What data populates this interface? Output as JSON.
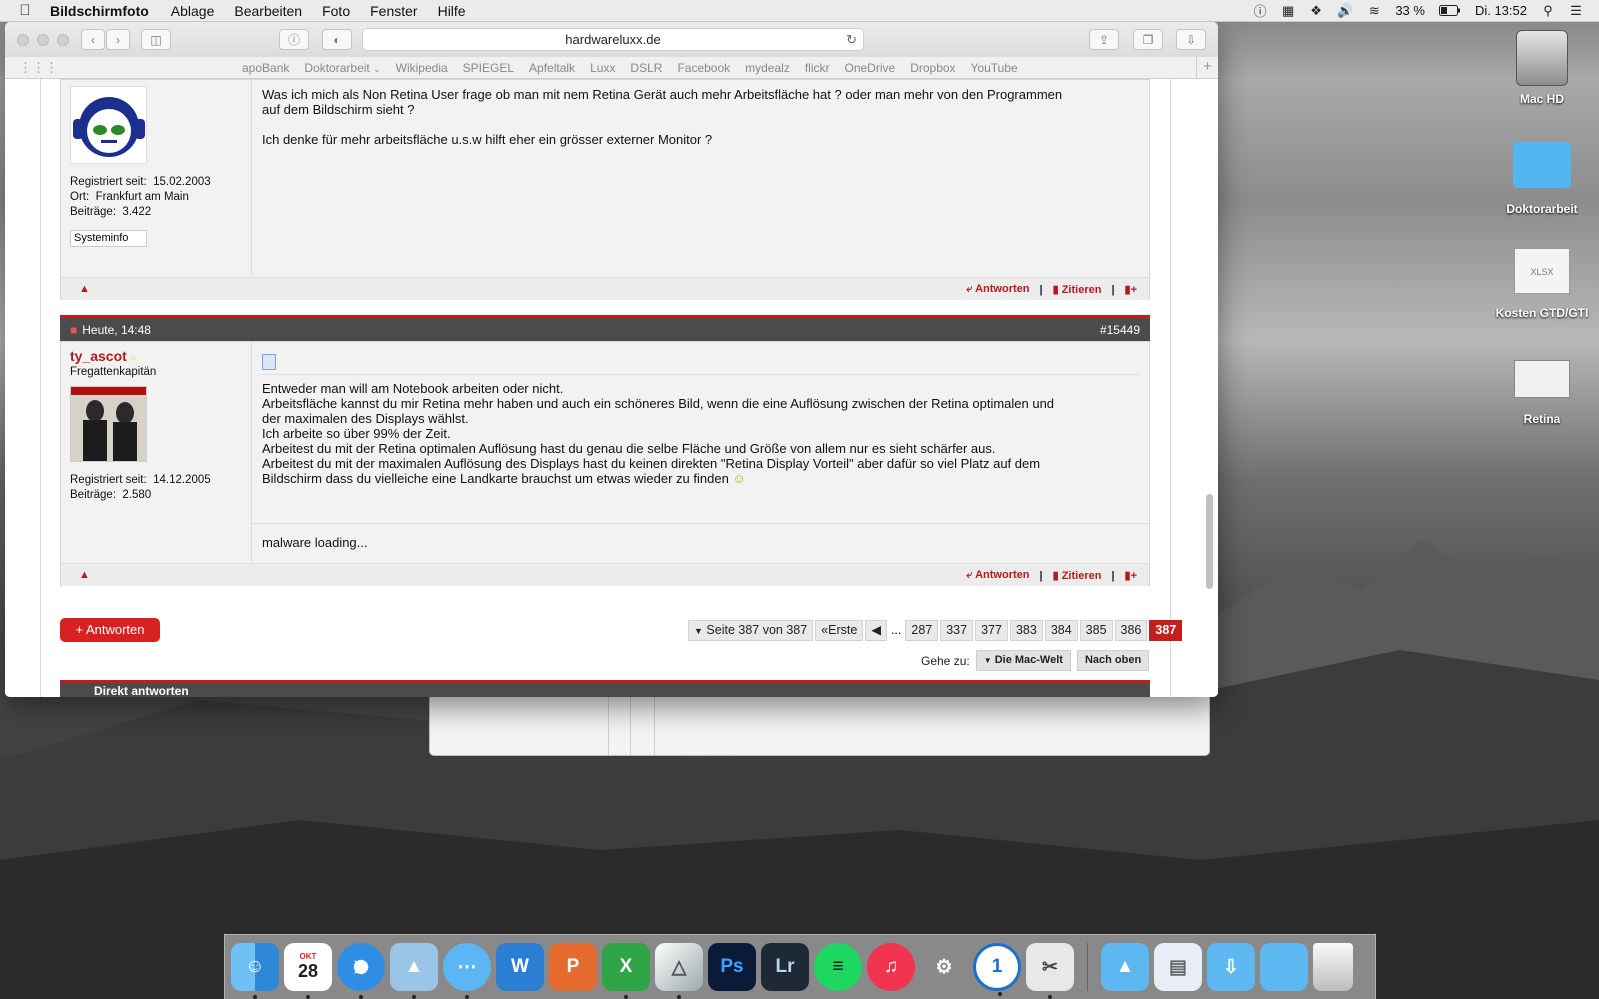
{
  "menubar": {
    "app": "Bildschirmfoto",
    "menus": [
      "Ablage",
      "Bearbeiten",
      "Foto",
      "Fenster",
      "Hilfe"
    ],
    "battery": "33 %",
    "clock": "Di. 13:52"
  },
  "desktop": {
    "icons": [
      {
        "label": "Mac HD"
      },
      {
        "label": "Doktorarbeit"
      },
      {
        "label": "Kosten GTD/GTI",
        "file_type": "XLSX"
      },
      {
        "label": "Retina"
      }
    ]
  },
  "safari": {
    "url": "hardwareluxx.de",
    "favorites": [
      "apoBank",
      "Doktorarbeit",
      "Wikipedia",
      "SPIEGEL",
      "Apfeltalk",
      "Luxx",
      "DSLR",
      "Facebook",
      "mydealz",
      "flickr",
      "OneDrive",
      "Dropbox",
      "YouTube"
    ]
  },
  "post1": {
    "text1": "Was ich mich als Non Retina User frage ob man mit nem Retina Gerät auch mehr Arbeitsfläche hat ? oder man mehr von den Programmen",
    "text2": "auf dem Bildschirm sieht ?",
    "text3": "Ich denke für mehr arbeitsfläche u.s.w hilft eher ein grösser externer Monitor ?",
    "registered_label": "Registriert seit:",
    "registered": "15.02.2003",
    "location_label": "Ort:",
    "location": "Frankfurt am Main",
    "posts_label": "Beiträge:",
    "posts": "3.422",
    "sysinfo": "Systeminfo"
  },
  "actions": {
    "reply": "Antworten",
    "quote": "Zitieren"
  },
  "post2": {
    "date": "Heute, 14:48",
    "number": "#15449",
    "author": "ty_ascot",
    "rank": "Fregattenkapitän",
    "registered_label": "Registriert seit:",
    "registered": "14.12.2005",
    "posts_label": "Beiträge:",
    "posts": "2.580",
    "lines": [
      "Entweder man will am Notebook arbeiten oder nicht.",
      "Arbeitsfläche kannst du mir Retina mehr haben und auch ein schöneres Bild, wenn die eine Auflösung zwischen der Retina optimalen und",
      "der maximalen des Displays wählst.",
      "Ich arbeite so über 99% der Zeit.",
      "Arbeitest du mit der Retina optimalen Auflösung hast du genau die selbe Fläche und Größe von allem nur es sieht schärfer aus.",
      "Arbeitest du mit der maximalen Auflösung des Displays hast du keinen direkten \"Retina Display Vorteil\" aber dafür so viel Platz auf dem",
      "Bildschirm dass du vielleiche eine Landkarte brauchst um etwas wieder zu finden"
    ],
    "signature": "malware loading..."
  },
  "footer": {
    "reply_button": "+ Antworten",
    "pager_label": "Seite 387 von 387",
    "first": "Erste",
    "ellipsis": "...",
    "pages": [
      "287",
      "337",
      "377",
      "383",
      "384",
      "385",
      "386"
    ],
    "current_page": "387",
    "goto_label": "Gehe zu:",
    "goto_forum": "Die Mac-Welt",
    "goto_top": "Nach oben",
    "quick_reply": "Direkt antworten"
  },
  "dock": {
    "calendar_month": "OKT",
    "calendar_day": "28",
    "apps": [
      "Finder",
      "Kalender",
      "Safari",
      "Vorschau",
      "Nachrichten",
      "Word",
      "PowerPoint",
      "Excel",
      "Prisma",
      "Photoshop",
      "Lightroom",
      "Spotify",
      "iTunes",
      "Systemeinstellungen",
      "1Password",
      "Bildschirmfoto"
    ]
  }
}
